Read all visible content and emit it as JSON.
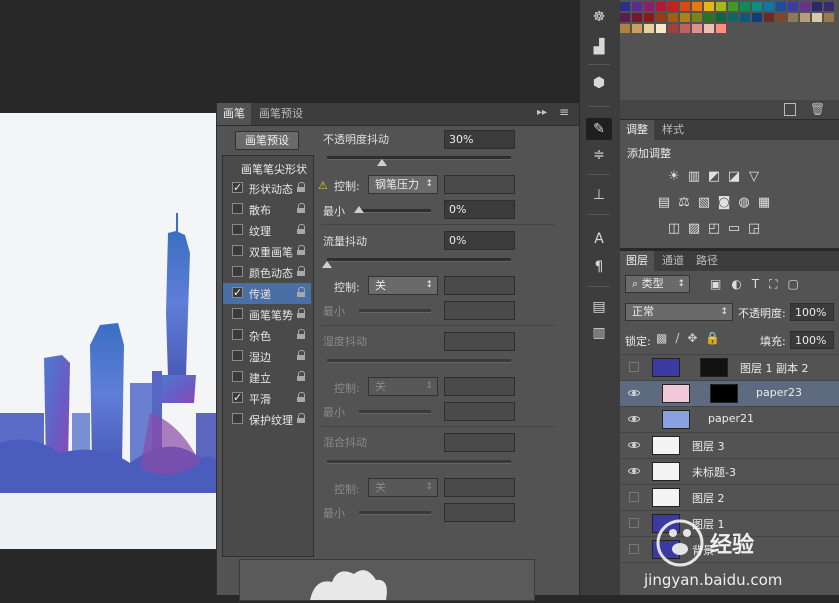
{
  "brush_panel": {
    "tabs": [
      "画笔",
      "画笔预设"
    ],
    "preset_button": "画笔预设",
    "tip_shape": "画笔笔尖形状",
    "options": [
      {
        "label": "形状动态",
        "checked": true,
        "selected": false
      },
      {
        "label": "散布",
        "checked": false,
        "selected": false
      },
      {
        "label": "纹理",
        "checked": false,
        "selected": false
      },
      {
        "label": "双重画笔",
        "checked": false,
        "selected": false
      },
      {
        "label": "颜色动态",
        "checked": false,
        "selected": false
      },
      {
        "label": "传递",
        "checked": true,
        "selected": true
      },
      {
        "label": "画笔笔势",
        "checked": false,
        "selected": false
      },
      {
        "label": "杂色",
        "checked": false,
        "selected": false
      },
      {
        "label": "湿边",
        "checked": false,
        "selected": false
      },
      {
        "label": "建立",
        "checked": false,
        "selected": false
      },
      {
        "label": "平滑",
        "checked": true,
        "selected": false
      },
      {
        "label": "保护纹理",
        "checked": false,
        "selected": false
      }
    ],
    "opacity_jitter": {
      "label": "不透明度抖动",
      "value": "30%",
      "level": 30
    },
    "control1": {
      "label": "控制:",
      "value": "钢笔压力"
    },
    "min1": {
      "label": "最小",
      "value": "0%"
    },
    "flow_jitter": {
      "label": "流量抖动",
      "value": "0%"
    },
    "control2": {
      "label": "控制:",
      "value": "关"
    },
    "min2": {
      "label": "最小"
    },
    "wetness_jitter": {
      "label": "湿度抖动"
    },
    "control3": {
      "label": "控制:",
      "value": "关"
    },
    "min3": {
      "label": "最小"
    },
    "mix_jitter": {
      "label": "混合抖动"
    },
    "control4": {
      "label": "控制:",
      "value": "关"
    },
    "min4": {
      "label": "最小"
    }
  },
  "adjustments": {
    "tabs": [
      "调整",
      "样式"
    ],
    "title": "添加调整",
    "icons": [
      "brightness-icon",
      "levels-icon",
      "curves-icon",
      "exposure-icon",
      "triangle-icon",
      "hue-icon",
      "balance-icon",
      "bw-icon",
      "photo-filter-icon",
      "channel-mixer-icon",
      "color-lookup-icon",
      "invert-icon",
      "posterize-icon",
      "threshold-icon",
      "gradient-map-icon",
      "selective-color-icon"
    ]
  },
  "layers": {
    "tabs": [
      "图层",
      "通道",
      "路径"
    ],
    "filter_kind": "类型",
    "blend_mode": "正常",
    "opacity_label": "不透明度:",
    "opacity_value": "100%",
    "lock_label": "锁定:",
    "fill_label": "填充:",
    "fill_value": "100%",
    "rows": [
      {
        "name": "图层 1 副本 2",
        "visible": false,
        "selected": false
      },
      {
        "name": "paper23",
        "visible": true,
        "selected": true
      },
      {
        "name": "paper21",
        "visible": true,
        "selected": false
      },
      {
        "name": "图层 3",
        "visible": true,
        "selected": false
      },
      {
        "name": "未标题-3",
        "visible": true,
        "selected": false
      },
      {
        "name": "图层 2",
        "visible": false,
        "selected": false
      },
      {
        "name": "图层 1",
        "visible": false,
        "selected": false
      },
      {
        "name": "背景",
        "visible": false,
        "selected": false
      }
    ]
  },
  "watermark": {
    "brand": "经验",
    "url": "jingyan.baidu.com"
  },
  "swatch_colors": [
    "#2b2f86",
    "#5b2d8a",
    "#8b1f6b",
    "#b0173d",
    "#c81e1e",
    "#d84a12",
    "#e07c10",
    "#e8b514",
    "#a8b81a",
    "#3e9a2c",
    "#138a55",
    "#0f8a86",
    "#1274a8",
    "#1d4e9e",
    "#3a3f9c",
    "#6b2f90",
    "#2a2a6a",
    "#3c2a6e",
    "#5e1b50",
    "#7e1330",
    "#8e1717",
    "#9a3a10",
    "#a35e0e",
    "#a88510",
    "#7a8614",
    "#2f7222",
    "#0e6642",
    "#0b6864",
    "#0e577e",
    "#163b76",
    "#6b2a2a",
    "#7a4a2a",
    "#8e7a5a",
    "#b59e7a",
    "#d8c9a8",
    "#9a7a4a",
    "#b08040",
    "#c8a060",
    "#e8d0a0",
    "#f8e8c8",
    "#a04040",
    "#c06060",
    "#e09090",
    "#f0c0b0",
    "#ff9080"
  ]
}
